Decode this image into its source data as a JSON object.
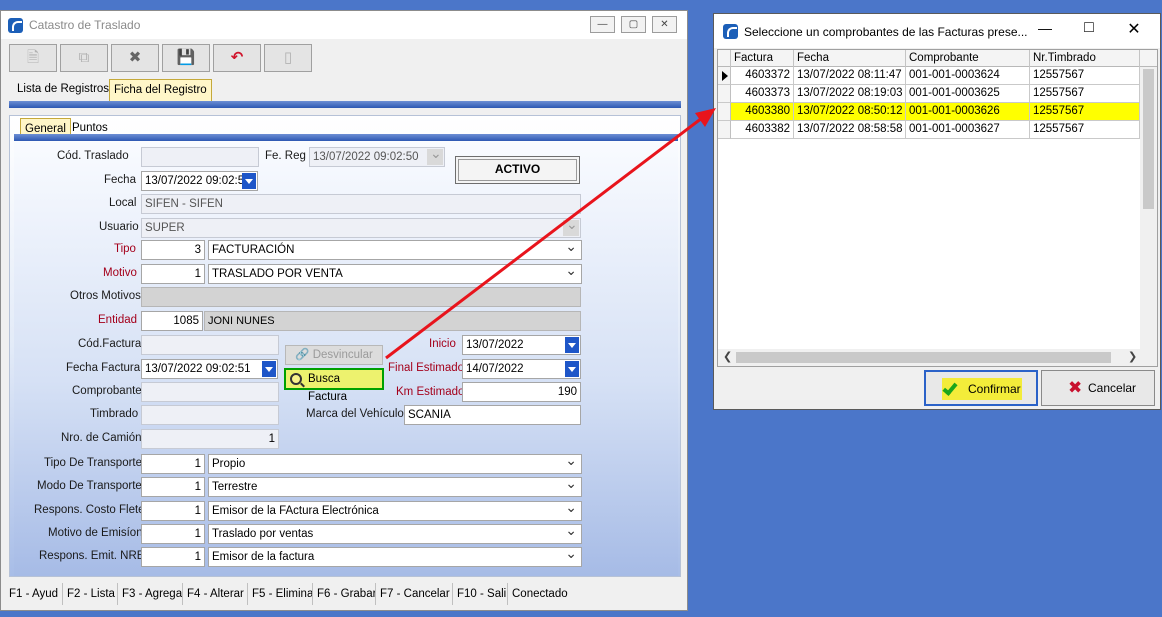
{
  "main_window": {
    "title": "Catastro de Traslado",
    "tabs": [
      "Lista de Registros",
      "Ficha del Registro"
    ],
    "subtabs": [
      "General",
      "Puntos"
    ],
    "status_badge": "ACTIVO",
    "labels": {
      "cod_traslado": "Cód. Traslado",
      "fe_reg": "Fe. Reg",
      "fecha": "Fecha",
      "local": "Local",
      "usuario": "Usuario",
      "tipo": "Tipo",
      "motivo": "Motivo",
      "otros_motivos": "Otros Motivos",
      "entidad": "Entidad",
      "cod_factura": "Cód.Factura",
      "fecha_factura": "Fecha Factura",
      "comprobante": "Comprobante",
      "timbrado": "Timbrado",
      "nro_camion": "Nro. de Camión",
      "tipo_transporte": "Tipo De Transporte",
      "modo_transporte": "Modo De Transporte",
      "respons_costo_flete": "Respons. Costo Flete",
      "motivo_emision": "Motivo de Emisíon",
      "respons_emit_nre": "Respons. Emit. NRE",
      "inicio": "Inicio",
      "final_estimado": "Final Estimado",
      "km_estimado": "Km Estimado",
      "marca_vehiculo": "Marca del Vehículo"
    },
    "values": {
      "fe_reg": "13/07/2022 09:02:50",
      "fecha": "13/07/2022 09:02:5",
      "local": "SIFEN - SIFEN",
      "usuario": "SUPER",
      "tipo_code": "3",
      "tipo_text": "FACTURACIÓN",
      "motivo_code": "1",
      "motivo_text": "TRASLADO POR VENTA",
      "entidad_code": "1085",
      "entidad_text": "JONI NUNES",
      "fecha_factura": "13/07/2022 09:02:51",
      "nro_camion": "1",
      "inicio": "13/07/2022",
      "final_estimado": "14/07/2022",
      "km_estimado": "190",
      "marca_vehiculo": "SCANIA",
      "tipo_transporte_code": "1",
      "tipo_transporte_text": "Propio",
      "modo_transporte_code": "1",
      "modo_transporte_text": "Terrestre",
      "respons_costo_flete_code": "1",
      "respons_costo_flete_text": "Emisor de la FActura Electrónica",
      "motivo_emision_code": "1",
      "motivo_emision_text": "Traslado por ventas",
      "respons_emit_nre_code": "1",
      "respons_emit_nre_text": "Emisor de la factura"
    },
    "buttons": {
      "desvincular": "Desvincular",
      "busca_factura": "Busca Factura"
    },
    "statusbar": [
      "F1 - Ayud",
      "F2 - Lista",
      "F3 - Agrega",
      "F4 - Alterar",
      "F5 - Elimina",
      "F6 - Grabar",
      "F7 - Cancelar",
      "F10 - Salir",
      "Conectado"
    ]
  },
  "dialog": {
    "title": "Seleccione un comprobantes de las Facturas prese...",
    "columns": [
      "Factura",
      "Fecha",
      "Comprobante",
      "Nr.Timbrado"
    ],
    "rows": [
      {
        "factura": "4603372",
        "fecha": "13/07/2022 08:11:47",
        "comprobante": "001-001-0003624",
        "timbrado": "12557567"
      },
      {
        "factura": "4603373",
        "fecha": "13/07/2022 08:19:03",
        "comprobante": "001-001-0003625",
        "timbrado": "12557567"
      },
      {
        "factura": "4603380",
        "fecha": "13/07/2022 08:50:12",
        "comprobante": "001-001-0003626",
        "timbrado": "12557567"
      },
      {
        "factura": "4603382",
        "fecha": "13/07/2022 08:58:58",
        "comprobante": "001-001-0003627",
        "timbrado": "12557567"
      }
    ],
    "confirm_label": "Confirmar",
    "cancel_label": "Cancelar"
  },
  "colors": {
    "desktop": "#4b76c9",
    "selected_row": "#ffff00",
    "label_required": "#a4001b",
    "highlight_button": "#edf26e",
    "arrow": "#e8141c"
  }
}
